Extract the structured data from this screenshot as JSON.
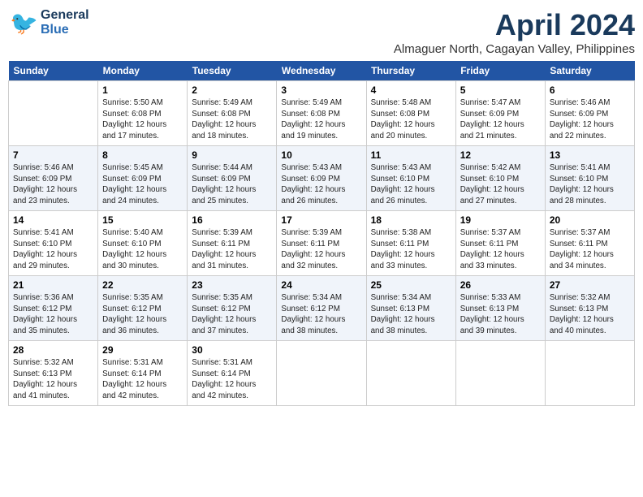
{
  "header": {
    "logo_general": "General",
    "logo_blue": "Blue",
    "month_title": "April 2024",
    "subtitle": "Almaguer North, Cagayan Valley, Philippines"
  },
  "weekdays": [
    "Sunday",
    "Monday",
    "Tuesday",
    "Wednesday",
    "Thursday",
    "Friday",
    "Saturday"
  ],
  "weeks": [
    [
      {
        "day": "",
        "info": ""
      },
      {
        "day": "1",
        "info": "Sunrise: 5:50 AM\nSunset: 6:08 PM\nDaylight: 12 hours\nand 17 minutes."
      },
      {
        "day": "2",
        "info": "Sunrise: 5:49 AM\nSunset: 6:08 PM\nDaylight: 12 hours\nand 18 minutes."
      },
      {
        "day": "3",
        "info": "Sunrise: 5:49 AM\nSunset: 6:08 PM\nDaylight: 12 hours\nand 19 minutes."
      },
      {
        "day": "4",
        "info": "Sunrise: 5:48 AM\nSunset: 6:08 PM\nDaylight: 12 hours\nand 20 minutes."
      },
      {
        "day": "5",
        "info": "Sunrise: 5:47 AM\nSunset: 6:09 PM\nDaylight: 12 hours\nand 21 minutes."
      },
      {
        "day": "6",
        "info": "Sunrise: 5:46 AM\nSunset: 6:09 PM\nDaylight: 12 hours\nand 22 minutes."
      }
    ],
    [
      {
        "day": "7",
        "info": "Sunrise: 5:46 AM\nSunset: 6:09 PM\nDaylight: 12 hours\nand 23 minutes."
      },
      {
        "day": "8",
        "info": "Sunrise: 5:45 AM\nSunset: 6:09 PM\nDaylight: 12 hours\nand 24 minutes."
      },
      {
        "day": "9",
        "info": "Sunrise: 5:44 AM\nSunset: 6:09 PM\nDaylight: 12 hours\nand 25 minutes."
      },
      {
        "day": "10",
        "info": "Sunrise: 5:43 AM\nSunset: 6:09 PM\nDaylight: 12 hours\nand 26 minutes."
      },
      {
        "day": "11",
        "info": "Sunrise: 5:43 AM\nSunset: 6:10 PM\nDaylight: 12 hours\nand 26 minutes."
      },
      {
        "day": "12",
        "info": "Sunrise: 5:42 AM\nSunset: 6:10 PM\nDaylight: 12 hours\nand 27 minutes."
      },
      {
        "day": "13",
        "info": "Sunrise: 5:41 AM\nSunset: 6:10 PM\nDaylight: 12 hours\nand 28 minutes."
      }
    ],
    [
      {
        "day": "14",
        "info": "Sunrise: 5:41 AM\nSunset: 6:10 PM\nDaylight: 12 hours\nand 29 minutes."
      },
      {
        "day": "15",
        "info": "Sunrise: 5:40 AM\nSunset: 6:10 PM\nDaylight: 12 hours\nand 30 minutes."
      },
      {
        "day": "16",
        "info": "Sunrise: 5:39 AM\nSunset: 6:11 PM\nDaylight: 12 hours\nand 31 minutes."
      },
      {
        "day": "17",
        "info": "Sunrise: 5:39 AM\nSunset: 6:11 PM\nDaylight: 12 hours\nand 32 minutes."
      },
      {
        "day": "18",
        "info": "Sunrise: 5:38 AM\nSunset: 6:11 PM\nDaylight: 12 hours\nand 33 minutes."
      },
      {
        "day": "19",
        "info": "Sunrise: 5:37 AM\nSunset: 6:11 PM\nDaylight: 12 hours\nand 33 minutes."
      },
      {
        "day": "20",
        "info": "Sunrise: 5:37 AM\nSunset: 6:11 PM\nDaylight: 12 hours\nand 34 minutes."
      }
    ],
    [
      {
        "day": "21",
        "info": "Sunrise: 5:36 AM\nSunset: 6:12 PM\nDaylight: 12 hours\nand 35 minutes."
      },
      {
        "day": "22",
        "info": "Sunrise: 5:35 AM\nSunset: 6:12 PM\nDaylight: 12 hours\nand 36 minutes."
      },
      {
        "day": "23",
        "info": "Sunrise: 5:35 AM\nSunset: 6:12 PM\nDaylight: 12 hours\nand 37 minutes."
      },
      {
        "day": "24",
        "info": "Sunrise: 5:34 AM\nSunset: 6:12 PM\nDaylight: 12 hours\nand 38 minutes."
      },
      {
        "day": "25",
        "info": "Sunrise: 5:34 AM\nSunset: 6:13 PM\nDaylight: 12 hours\nand 38 minutes."
      },
      {
        "day": "26",
        "info": "Sunrise: 5:33 AM\nSunset: 6:13 PM\nDaylight: 12 hours\nand 39 minutes."
      },
      {
        "day": "27",
        "info": "Sunrise: 5:32 AM\nSunset: 6:13 PM\nDaylight: 12 hours\nand 40 minutes."
      }
    ],
    [
      {
        "day": "28",
        "info": "Sunrise: 5:32 AM\nSunset: 6:13 PM\nDaylight: 12 hours\nand 41 minutes."
      },
      {
        "day": "29",
        "info": "Sunrise: 5:31 AM\nSunset: 6:14 PM\nDaylight: 12 hours\nand 42 minutes."
      },
      {
        "day": "30",
        "info": "Sunrise: 5:31 AM\nSunset: 6:14 PM\nDaylight: 12 hours\nand 42 minutes."
      },
      {
        "day": "",
        "info": ""
      },
      {
        "day": "",
        "info": ""
      },
      {
        "day": "",
        "info": ""
      },
      {
        "day": "",
        "info": ""
      }
    ]
  ]
}
